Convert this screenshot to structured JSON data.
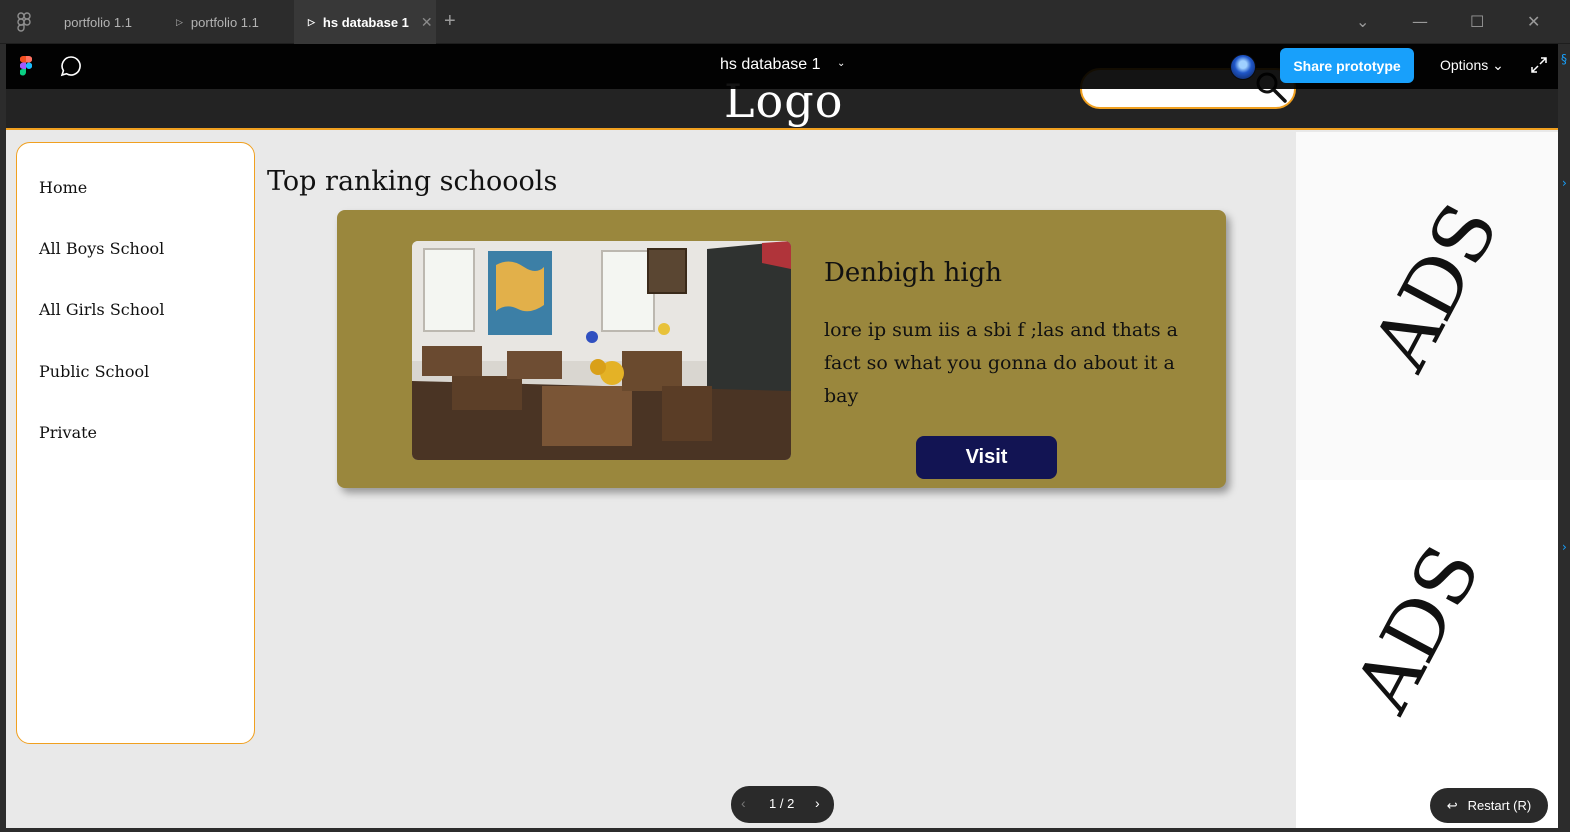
{
  "tabs": [
    {
      "label": "portfolio 1.1",
      "prototype": false,
      "active": false
    },
    {
      "label": "portfolio 1.1",
      "prototype": true,
      "active": false
    },
    {
      "label": "hs database 1",
      "prototype": true,
      "active": true
    }
  ],
  "tab_add": "+",
  "window_controls": {
    "dropdown": "⌄",
    "minimize": "—",
    "maximize": "☐",
    "close": "✕"
  },
  "viewer": {
    "file_title": "hs database 1",
    "title_chevron": "⌄",
    "share_label": "Share prototype",
    "options_label": "Options ⌄",
    "accent": "#18a0fb"
  },
  "header": {
    "logo": "Logo",
    "search_placeholder": "",
    "accent": "#f0a020"
  },
  "nav": {
    "items": [
      "Home",
      "All Boys School",
      "All Girls School",
      "Public School",
      "Private"
    ]
  },
  "main": {
    "section_title": "Top ranking schoools",
    "card": {
      "name": "Denbigh high",
      "description": "lore ip sum iis a sbi f ;las and thats a fact so what you gonna do about it a bay",
      "visit_label": "Visit",
      "card_color": "#9a873d",
      "button_color": "#121453"
    }
  },
  "ads": [
    "ADS",
    "ADS"
  ],
  "pager": {
    "prev": "‹",
    "count": "1 / 2",
    "next": "›"
  },
  "restart": {
    "arrow": "↩",
    "label": "Restart (R)"
  }
}
